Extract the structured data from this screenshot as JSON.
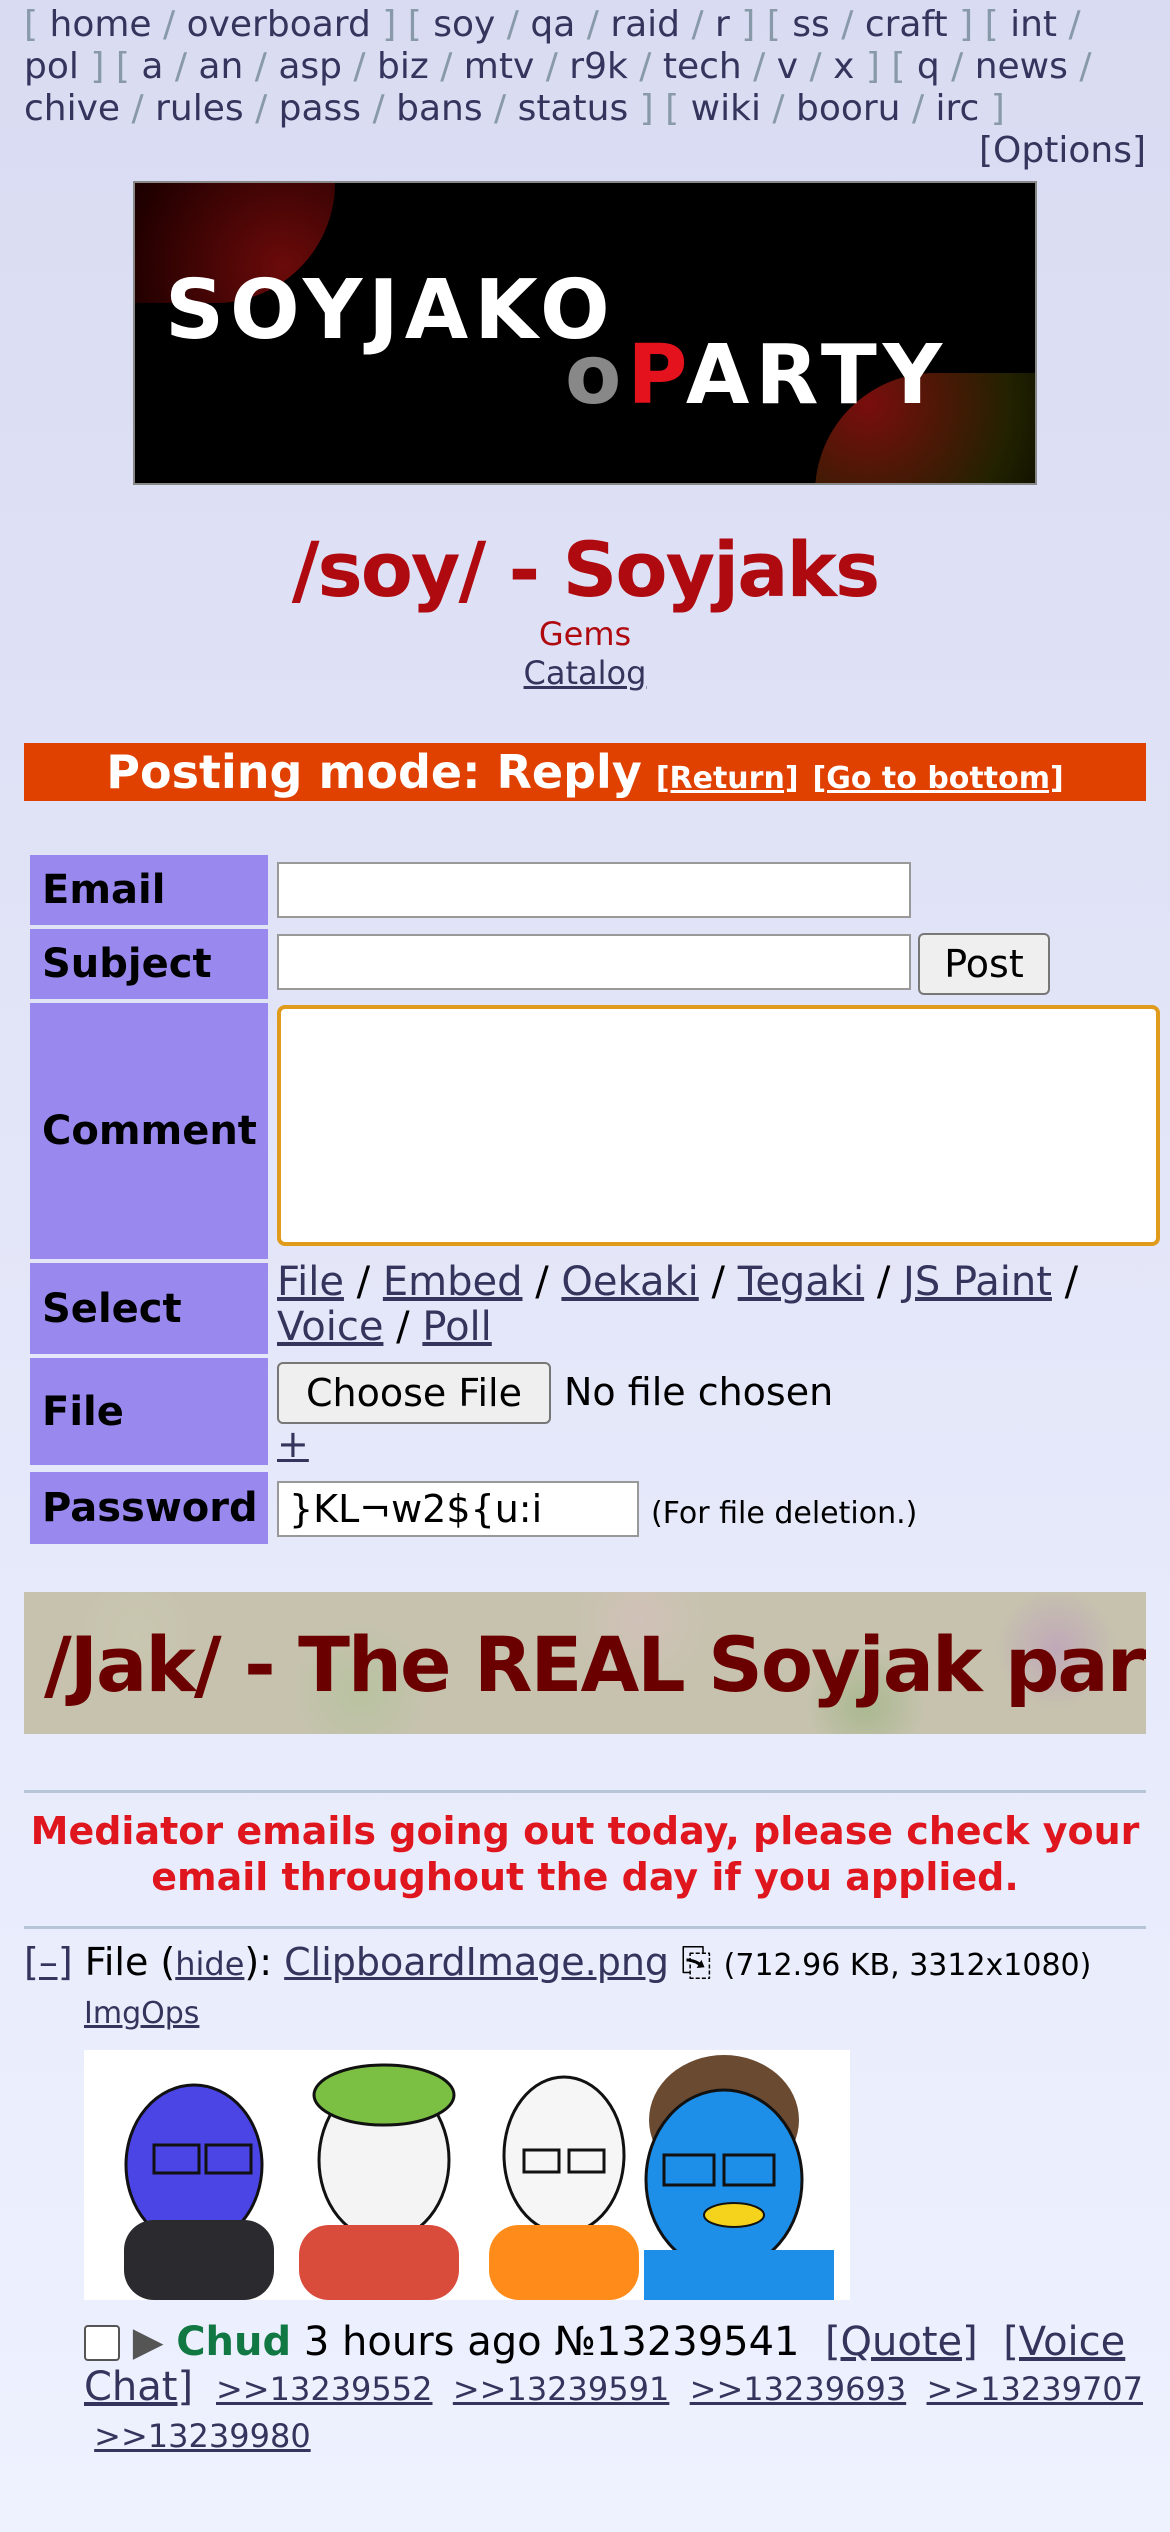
{
  "nav": {
    "groups": [
      [
        "home",
        "overboard"
      ],
      [
        "soy",
        "qa",
        "raid",
        "r"
      ],
      [
        "ss",
        "craft"
      ],
      [
        "int",
        "pol"
      ],
      [
        "a",
        "an",
        "asp",
        "biz",
        "mtv",
        "r9k",
        "tech",
        "v",
        "x"
      ],
      [
        "q",
        "news",
        "chive",
        "rules",
        "pass",
        "bans",
        "status"
      ],
      [
        "wiki",
        "booru",
        "irc"
      ]
    ],
    "options": "[Options]"
  },
  "banner": {
    "line1": "SOYJAKO",
    "o": "o",
    "p": "P",
    "rest": "ARTY"
  },
  "board": {
    "title": "/soy/ - Soyjaks",
    "subtitle": "Gems",
    "catalog": "Catalog"
  },
  "posting_mode": {
    "label": "Posting mode: Reply",
    "return": "[Return]",
    "bottom": "[Go to bottom]"
  },
  "form": {
    "email_label": "Email",
    "subject_label": "Subject",
    "post_button": "Post",
    "comment_label": "Comment",
    "select_label": "Select",
    "select_options": [
      "File",
      "Embed",
      "Oekaki",
      "Tegaki",
      "JS Paint",
      "Voice",
      "Poll"
    ],
    "file_label": "File",
    "choose_file": "Choose File",
    "no_file": "No file chosen",
    "plus": "+",
    "password_label": "Password",
    "password_value": "}KL¬w2${u:i",
    "password_note": "(For file deletion.)"
  },
  "jak_banner": "/Jak/ - The REAL Soyjak party",
  "announcement": "Mediator emails going out today, please check your email throughout the day if you applied.",
  "post": {
    "collapse": "[–]",
    "file_word": "File",
    "hide": "hide",
    "filename": "ClipboardImage.png",
    "file_info": "(712.96 KB, 3312x1080)",
    "imgops": "ImgOps",
    "name": "Chud",
    "time": "3 hours ago",
    "number": "№13239541",
    "quote": "[Quote]",
    "voice_chat": "[Voice Chat]",
    "replies": [
      ">>13239552",
      ">>13239591",
      ">>13239693",
      ">>13239707",
      ">>13239980"
    ]
  },
  "colors": {
    "accent_red": "#af0a0f",
    "posting_mode_bg": "#e04000",
    "label_bg": "#9988ee",
    "name_green": "#117743",
    "focus_orange": "#e09a1c"
  }
}
